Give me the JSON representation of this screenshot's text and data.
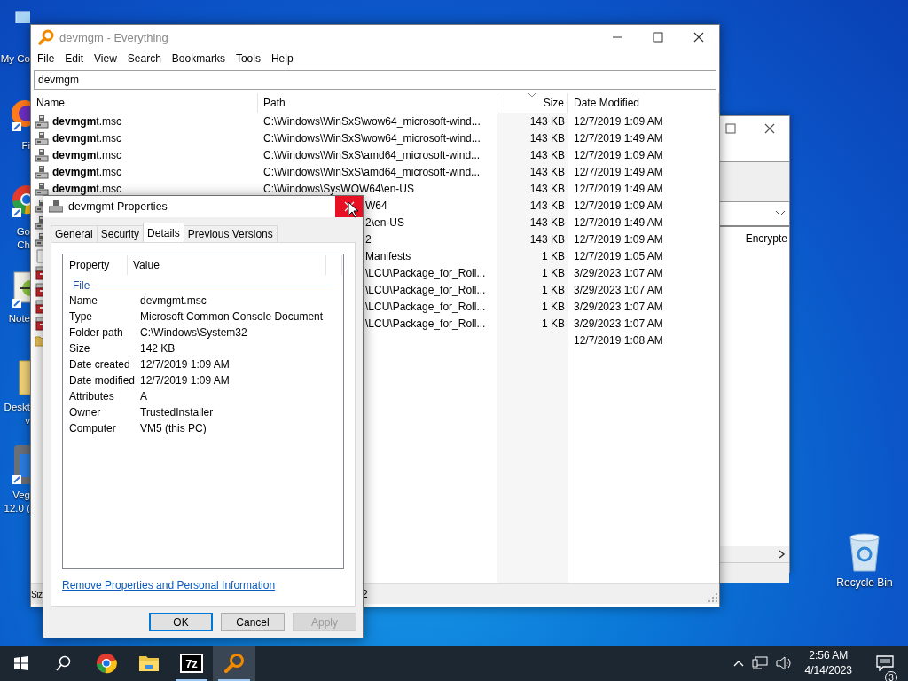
{
  "desktop_icons": [
    {
      "kind": "computer",
      "label_lines": [
        "My Co"
      ]
    },
    {
      "kind": "firefox",
      "label_lines": [
        "Fi"
      ]
    },
    {
      "kind": "chrome",
      "label_lines": [
        "Go",
        "Ch"
      ]
    },
    {
      "kind": "notepad",
      "label_lines": [
        "Note"
      ]
    },
    {
      "kind": "folder",
      "label_lines": [
        "Deskt",
        "v"
      ]
    },
    {
      "kind": "vegas",
      "label_lines": [
        "Veg",
        "12.0 ("
      ]
    }
  ],
  "recycle_bin": {
    "label": "Recycle Bin"
  },
  "background_window": {
    "column_header": "Encrypte"
  },
  "everything": {
    "title": "devmgm - Everything",
    "menu": [
      "File",
      "Edit",
      "View",
      "Search",
      "Bookmarks",
      "Tools",
      "Help"
    ],
    "search": {
      "value": "devmgm"
    },
    "columns": [
      {
        "label": "Name",
        "sorted": false
      },
      {
        "label": "Path",
        "sorted": false
      },
      {
        "label": "Size",
        "sorted": true
      },
      {
        "label": "Date Modified",
        "sorted": false
      }
    ],
    "rows": [
      {
        "kind": "console",
        "name": "**devmgm**t.msc",
        "path": "C:\\Windows\\WinSxS\\wow64_microsoft-wind...",
        "size": "143 KB",
        "date": "12/7/2019 1:09 AM"
      },
      {
        "kind": "console",
        "name": "**devmgm**t.msc",
        "path": "C:\\Windows\\WinSxS\\wow64_microsoft-wind...",
        "size": "143 KB",
        "date": "12/7/2019 1:49 AM"
      },
      {
        "kind": "console",
        "name": "**devmgm**t.msc",
        "path": "C:\\Windows\\WinSxS\\amd64_microsoft-wind...",
        "size": "143 KB",
        "date": "12/7/2019 1:09 AM"
      },
      {
        "kind": "console",
        "name": "**devmgm**t.msc",
        "path": "C:\\Windows\\WinSxS\\amd64_microsoft-wind...",
        "size": "143 KB",
        "date": "12/7/2019 1:49 AM"
      },
      {
        "kind": "console",
        "name": "**devmgm**t.msc",
        "path": "C:\\Windows\\SysWOW64\\en-US",
        "size": "143 KB",
        "date": "12/7/2019 1:49 AM"
      },
      {
        "kind": "console",
        "path": "W64",
        "size": "143 KB",
        "date": "12/7/2019 1:09 AM"
      },
      {
        "kind": "console",
        "path": "2\\en-US",
        "size": "143 KB",
        "date": "12/7/2019 1:49 AM"
      },
      {
        "kind": "console",
        "path": "2",
        "size": "143 KB",
        "date": "12/7/2019 1:09 AM"
      },
      {
        "kind": "file",
        "path": "Manifests",
        "size": "1 KB",
        "date": "12/7/2019 1:05 AM"
      },
      {
        "kind": "package",
        "path": "\\LCU\\Package_for_Roll...",
        "size": "1 KB",
        "date": "3/29/2023 1:07 AM"
      },
      {
        "kind": "package",
        "path": "\\LCU\\Package_for_Roll...",
        "size": "1 KB",
        "date": "3/29/2023 1:07 AM"
      },
      {
        "kind": "package",
        "path": "\\LCU\\Package_for_Roll...",
        "size": "1 KB",
        "date": "3/29/2023 1:07 AM"
      },
      {
        "kind": "package",
        "path": "\\LCU\\Package_for_Roll...",
        "size": "1 KB",
        "date": "3/29/2023 1:07 AM"
      },
      {
        "kind": "folder",
        "date": "12/7/2019 1:08 AM"
      }
    ],
    "status_bar": [
      "Siz",
      "2"
    ]
  },
  "dialog": {
    "title": "devmgmt Properties",
    "close_hover": true,
    "tabs": [
      {
        "label": "General",
        "selected": false
      },
      {
        "label": "Security",
        "selected": false
      },
      {
        "label": "Details",
        "selected": true
      },
      {
        "label": "Previous Versions",
        "selected": false
      }
    ],
    "columns": [
      "Property",
      "Value"
    ],
    "group": "File",
    "properties": [
      {
        "name": "Name",
        "value": "devmgmt.msc"
      },
      {
        "name": "Type",
        "value": "Microsoft Common Console Document"
      },
      {
        "name": "Folder path",
        "value": "C:\\Windows\\System32"
      },
      {
        "name": "Size",
        "value": "142 KB"
      },
      {
        "name": "Date created",
        "value": "12/7/2019 1:09 AM"
      },
      {
        "name": "Date modified",
        "value": "12/7/2019 1:09 AM"
      },
      {
        "name": "Attributes",
        "value": "A"
      },
      {
        "name": "Owner",
        "value": "TrustedInstaller"
      },
      {
        "name": "Computer",
        "value": "VM5 (this PC)"
      }
    ],
    "link": "Remove Properties and Personal Information",
    "buttons": [
      {
        "label": "OK",
        "default": true,
        "disabled": false
      },
      {
        "label": "Cancel",
        "default": false,
        "disabled": false
      },
      {
        "label": "Apply",
        "default": false,
        "disabled": true
      }
    ]
  },
  "taskbar": {
    "apps": [
      {
        "kind": "chrome",
        "active": false,
        "running": false
      },
      {
        "kind": "explorer",
        "active": false,
        "running": false
      },
      {
        "kind": "sevenzip",
        "label": "7z",
        "active": false,
        "running": true
      },
      {
        "kind": "everything",
        "active": true,
        "running": true
      }
    ],
    "time": "2:56 AM",
    "date": "4/14/2023",
    "notifications": "3"
  }
}
